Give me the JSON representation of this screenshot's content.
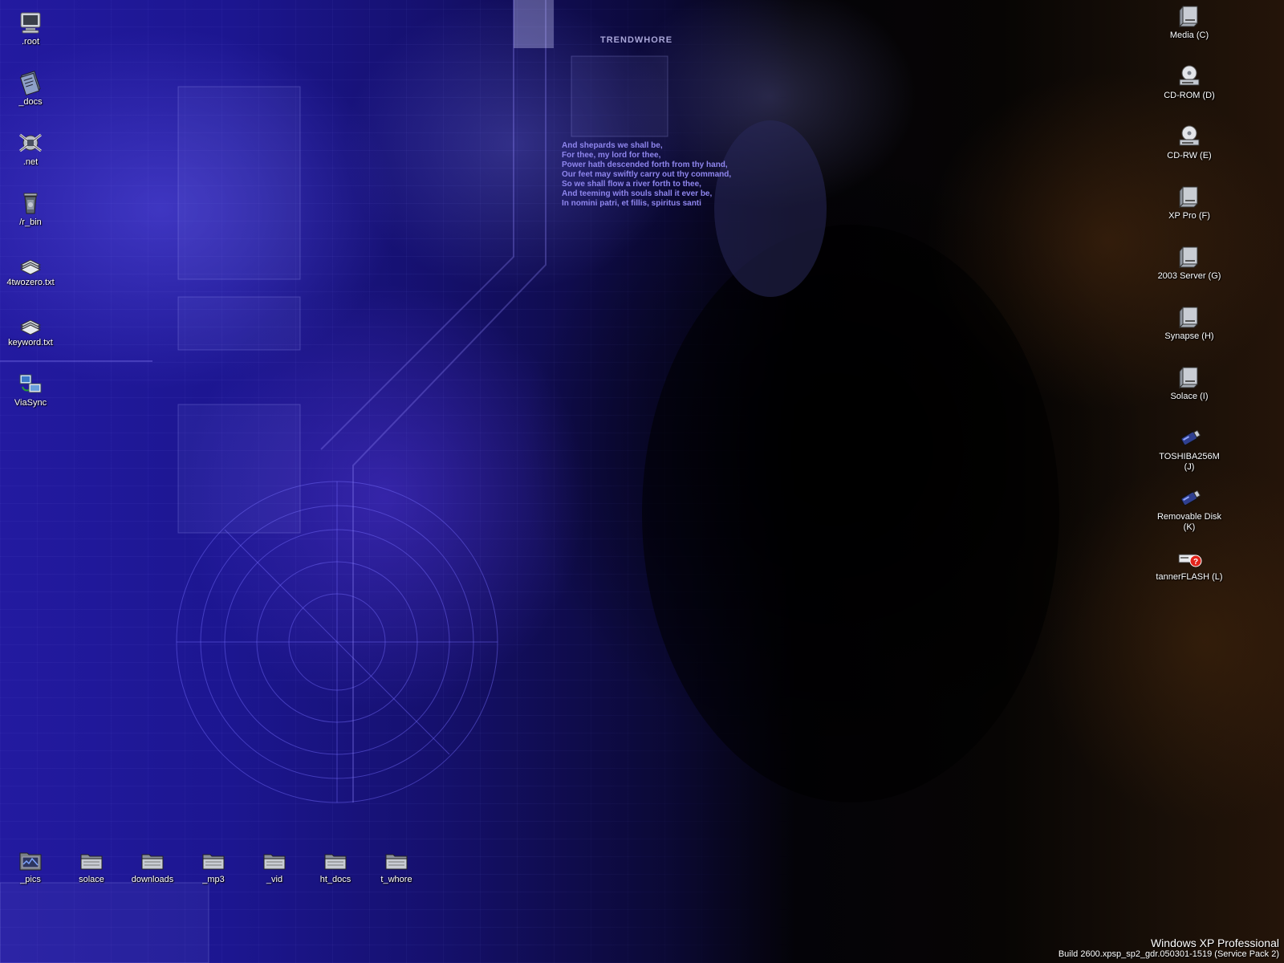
{
  "wallpaper": {
    "brand_text": "TRENDWHORE",
    "poem_lines": [
      "And shepards we shall be,",
      "For thee, my lord for thee,",
      "Power hath descended forth from thy hand,",
      "Our feet may swiftly carry out thy command,",
      "So we shall flow a river forth to thee,",
      "And teeming with souls shall it ever be,",
      "In nomini patri, et fillis, spiritus santi"
    ]
  },
  "left_icons": [
    {
      "label": ".root",
      "icon": "computer-icon"
    },
    {
      "label": "_docs",
      "icon": "documents-icon"
    },
    {
      "label": ".net",
      "icon": "network-icon"
    },
    {
      "label": "/r_bin",
      "icon": "recycle-bin-icon"
    },
    {
      "label": "4twozero.txt",
      "icon": "text-file-icon"
    },
    {
      "label": "keyword.txt",
      "icon": "text-file-icon"
    },
    {
      "label": "ViaSync",
      "icon": "sync-icon"
    }
  ],
  "bottom_icons": [
    {
      "label": "_pics",
      "icon": "pictures-folder-icon"
    },
    {
      "label": "solace",
      "icon": "folder-icon"
    },
    {
      "label": "downloads",
      "icon": "folder-icon"
    },
    {
      "label": "_mp3",
      "icon": "folder-icon"
    },
    {
      "label": "_vid",
      "icon": "folder-icon"
    },
    {
      "label": "ht_docs",
      "icon": "folder-icon"
    },
    {
      "label": "t_whore",
      "icon": "folder-icon"
    }
  ],
  "right_icons": [
    {
      "label": "Media (C)",
      "icon": "hard-drive-icon"
    },
    {
      "label": "CD-ROM (D)",
      "icon": "cd-drive-icon"
    },
    {
      "label": "CD-RW (E)",
      "icon": "cd-drive-icon"
    },
    {
      "label": "XP Pro (F)",
      "icon": "hard-drive-icon"
    },
    {
      "label": "2003 Server (G)",
      "icon": "hard-drive-icon"
    },
    {
      "label": "Synapse (H)",
      "icon": "hard-drive-icon"
    },
    {
      "label": "Solace (I)",
      "icon": "hard-drive-icon"
    },
    {
      "label": "TOSHIBA256M (J)",
      "icon": "usb-drive-icon"
    },
    {
      "label": "Removable Disk (K)",
      "icon": "usb-drive-icon"
    },
    {
      "label": "tannerFLASH (L)",
      "icon": "unknown-drive-icon"
    }
  ],
  "watermark": {
    "os": "Windows XP Professional",
    "build": "Build 2600.xpsp_sp2_gdr.050301-1519 (Service Pack 2)"
  },
  "colors": {
    "poem_text": "#8f86ee",
    "icon_label": "#ffffff",
    "wallpaper_blue": "#231aa0",
    "wallpaper_brown": "#241409"
  }
}
